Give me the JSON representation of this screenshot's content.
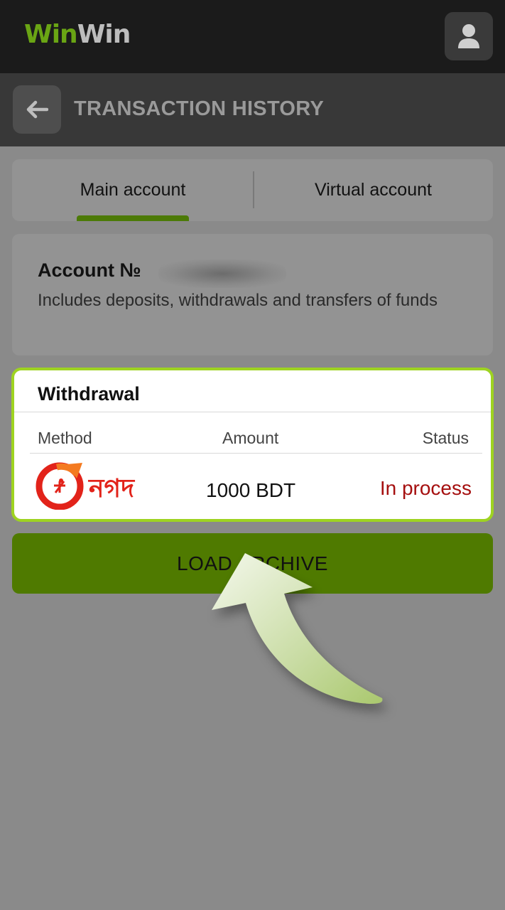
{
  "header": {
    "logo_part1": "Win",
    "logo_part2": "Win",
    "profile_icon": "user-icon"
  },
  "titlebar": {
    "back_icon": "arrow-left-icon",
    "title": "TRANSACTION HISTORY"
  },
  "tabs": [
    {
      "label": "Main account",
      "active": true
    },
    {
      "label": "Virtual account",
      "active": false
    }
  ],
  "account": {
    "title": "Account №",
    "description": "Includes deposits, withdrawals and transfers of funds"
  },
  "transaction": {
    "type": "Withdrawal",
    "columns": [
      "Method",
      "Amount",
      "Status"
    ],
    "method_logo_text": "নগদ",
    "method_icon": "nagad-logo",
    "amount": "1000 BDT",
    "status": "In process"
  },
  "load_button": {
    "label": "LOAD ARCHIVE"
  },
  "colors": {
    "accent_green": "#4f7a00",
    "highlight_border": "#9ed321",
    "status_red": "#a50f0f",
    "logo_green": "#6aa514"
  }
}
